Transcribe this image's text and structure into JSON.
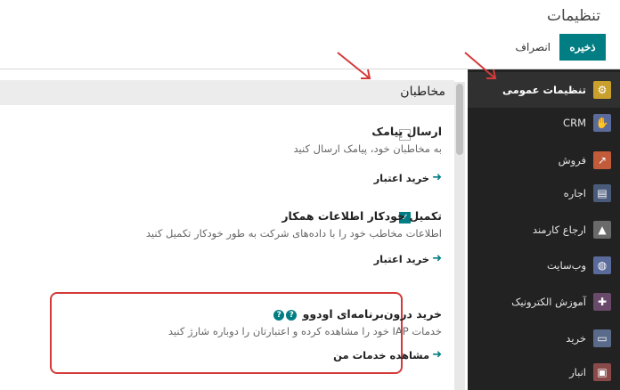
{
  "header": {
    "title": "تنظیمات",
    "save_label": "ذخیره",
    "discard_label": "انصراف"
  },
  "section": {
    "title": "مخاطبان"
  },
  "settings": [
    {
      "title": "ارسال پیامک",
      "description": "به مخاطبان خود، پیامک ارسال کنید",
      "link": "خرید اعتبار",
      "checked": false
    },
    {
      "title": "تکمیل خودکار اطلاعات همکار",
      "description": "اطلاعات مخاطب خود را با داده‌های شرکت به طور خودکار تکمیل کنید",
      "link": "خرید اعتبار",
      "checked": true
    },
    {
      "title": "خرید درون‌برنامه‌ای اودوو",
      "description": "خدمات IAP خود را مشاهده کرده و اعتبارتان را دوباره شارژ کنید",
      "link": "مشاهده خدمات من"
    }
  ],
  "sidebar": {
    "items": [
      {
        "label": "تنظیمات عمومی",
        "icon": "gear-icon",
        "color": "#8e7a3c",
        "active": true
      },
      {
        "label": "CRM",
        "icon": "handshake-icon",
        "color": "#5a6a9a"
      },
      {
        "label": "فروش",
        "icon": "chart-icon",
        "color": "#c25b3a"
      },
      {
        "label": "اجاره",
        "icon": "calendar-icon",
        "color": "#4a5a7a"
      },
      {
        "label": "ارجاع کارمند",
        "icon": "tree-icon",
        "color": "#6a6a6a"
      },
      {
        "label": "وب‌سایت",
        "icon": "globe-icon",
        "color": "#5a6a9a"
      },
      {
        "label": "آموزش الکترونیک",
        "icon": "puzzle-icon",
        "color": "#6a4a6a"
      },
      {
        "label": "خرید",
        "icon": "card-icon",
        "color": "#5a6a8a"
      },
      {
        "label": "انبار",
        "icon": "box-icon",
        "color": "#8a4a4a"
      }
    ]
  },
  "colors": {
    "accent": "#017e84",
    "sidebar_bg": "#222222",
    "highlight": "#d43a3a"
  }
}
